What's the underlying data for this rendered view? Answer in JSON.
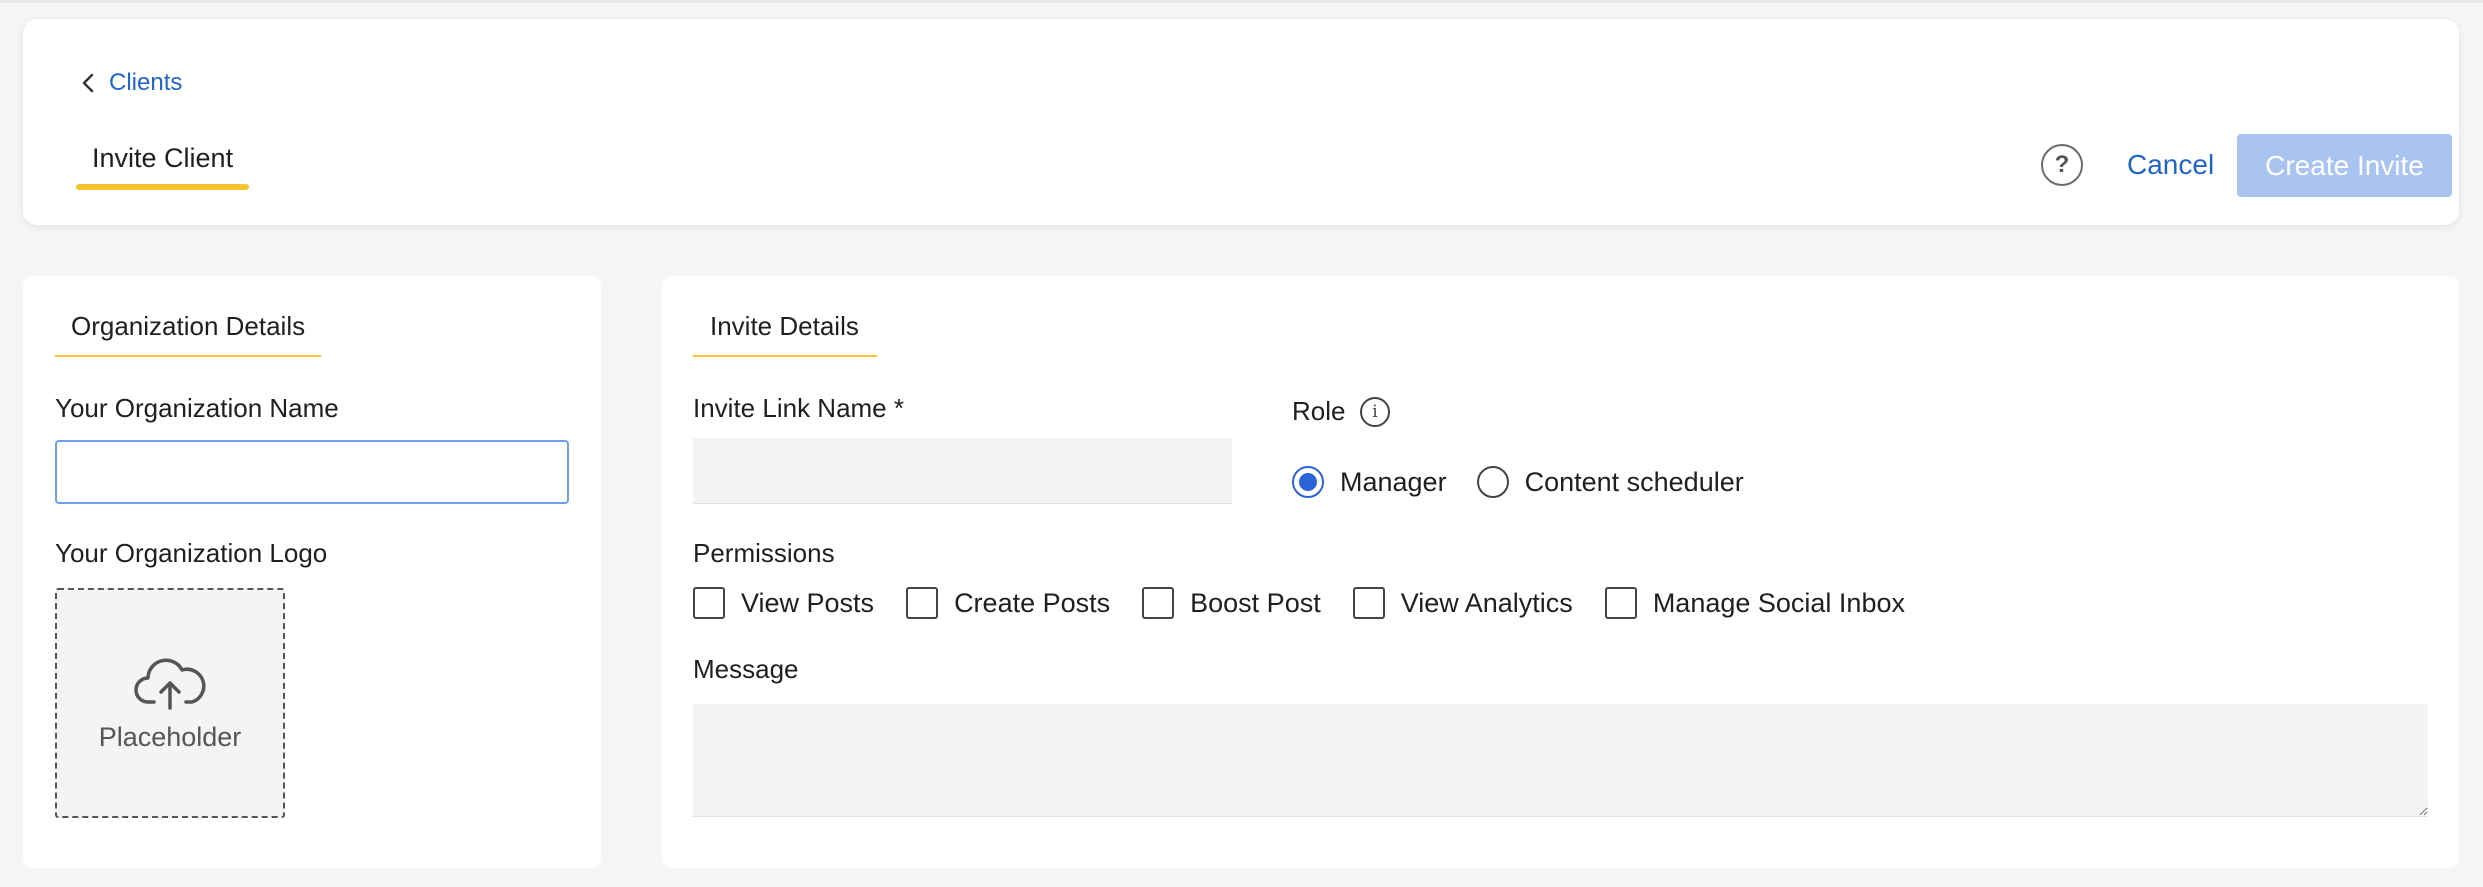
{
  "header": {
    "breadcrumb_label": "Clients",
    "page_title": "Invite Client",
    "help_label": "?",
    "cancel_label": "Cancel",
    "create_label": "Create Invite"
  },
  "organization": {
    "section_title": "Organization Details",
    "name_label": "Your Organization Name",
    "name_value": "",
    "logo_label": "Your Organization Logo",
    "logo_placeholder": "Placeholder"
  },
  "invite": {
    "section_title": "Invite Details",
    "link_name_label": "Invite Link Name *",
    "link_name_value": "",
    "role_label": "Role",
    "role_options": [
      {
        "label": "Manager",
        "checked": true
      },
      {
        "label": "Content scheduler",
        "checked": false
      }
    ],
    "permissions_label": "Permissions",
    "permissions": [
      "View Posts",
      "Create Posts",
      "Boost Post",
      "View Analytics",
      "Manage Social Inbox"
    ],
    "message_label": "Message",
    "message_value": ""
  },
  "colors": {
    "accent": "#2166c6",
    "underline": "#f5c32c",
    "disabled_button": "#a9c4f0",
    "radio_selected": "#2d63d8"
  },
  "icons": [
    "chevron-left-icon",
    "help-icon",
    "upload-cloud-icon",
    "info-icon"
  ]
}
